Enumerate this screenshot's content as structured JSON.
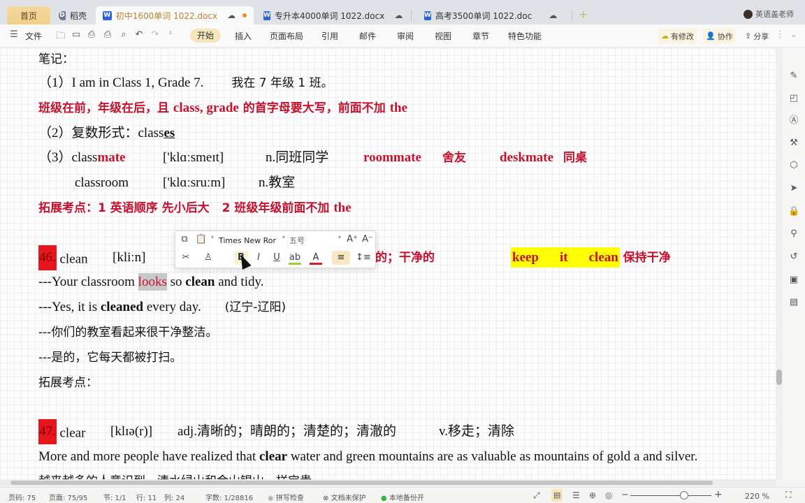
{
  "tabs": {
    "home": "首页",
    "daoke": "稻壳",
    "active": "初中1600单词 1022.docx",
    "tab2": "专升本4000单词 1022.docx",
    "tab3": "高考3500单词 1022.doc",
    "new_tab": "+",
    "user": "英语盖老师"
  },
  "toolbar": {
    "menu": "文件",
    "tabs": [
      "开始",
      "插入",
      "页面布局",
      "引用",
      "邮件",
      "审阅",
      "视图",
      "章节",
      "特色功能"
    ],
    "modified": "有修改",
    "collab": "协作",
    "share": "分享"
  },
  "doc": {
    "l1": "笔记：",
    "l2_a": "（1）I am in Class 1, Grade 7.",
    "l2_b": "我在 7 年级 1 班。",
    "l3_a": "班级在前，年级在后，且 ",
    "l3_b": "class, grade",
    "l3_c": " 的首字母要大写，前面不加  ",
    "l3_d": "the",
    "l4_a": "（2）复数形式：class",
    "l4_b": "es",
    "l5_a": "（3）class",
    "l5_b": "mate",
    "l5_c": "['klɑːsmeɪt]",
    "l5_d": "n.同班同学",
    "l5_e": "roommate",
    "l5_f": "舍友",
    "l5_g": "deskmate",
    "l5_h": "同桌",
    "l6_a": "classroom",
    "l6_b": "['klɑːsruːm]",
    "l6_c": "n.教室",
    "l7_a": "拓展考点：1 英语顺序  先小后大",
    "l7_b": "2 班级年级前面不加  ",
    "l7_c": "the",
    "w46_num": "46.",
    "w46_word": "clean",
    "w46_ipa": "[kliːn]",
    "w46_def": "的；干净的",
    "w46_phrase_a": "keep",
    "w46_phrase_b": "it",
    "w46_phrase_c": "clean",
    "w46_phrase_cn": "保持干净",
    "ex1_a": "---Your classroom ",
    "ex1_b": "looks",
    "ex1_c": " so ",
    "ex1_d": "clean",
    "ex1_e": " and tidy.",
    "ex2_a": "---Yes, it is ",
    "ex2_b": "cleaned",
    "ex2_c": " every day.",
    "ex2_d": "(辽宁-辽阳)",
    "ex3": "---你们的教室看起来很干净整洁。",
    "ex4": "---是的，它每天都被打扫。",
    "ext": "拓展考点：",
    "w47_num": "47.",
    "w47_word": "clear",
    "w47_ipa": "[klɪə(r)]",
    "w47_def_a": "adj.清晰的；晴朗的；清楚的；清澈的",
    "w47_def_b": "v.移走；清除",
    "ex5_a": "More and more people have realized that ",
    "ex5_b": "clear",
    "ex5_c": " water and green mountains are as valuable as mountains of gold a and silver.",
    "ex6": "越来越多的人意识到，清水绿山和金山银山一样宝贵。"
  },
  "mini_toolbar": {
    "font": "Times New Ror",
    "size": "五号"
  },
  "status": {
    "page_num": "页码: 75",
    "pages": "页面: 75/95",
    "section": "节: 1/1",
    "row": "行: 11",
    "col": "列: 24",
    "words": "字数: 1/28816",
    "spell": "拼写检查",
    "protect": "文档未保护",
    "backup": "本地备份开",
    "zoom": "220 %",
    "zoom_level_fraction": 0.66
  }
}
